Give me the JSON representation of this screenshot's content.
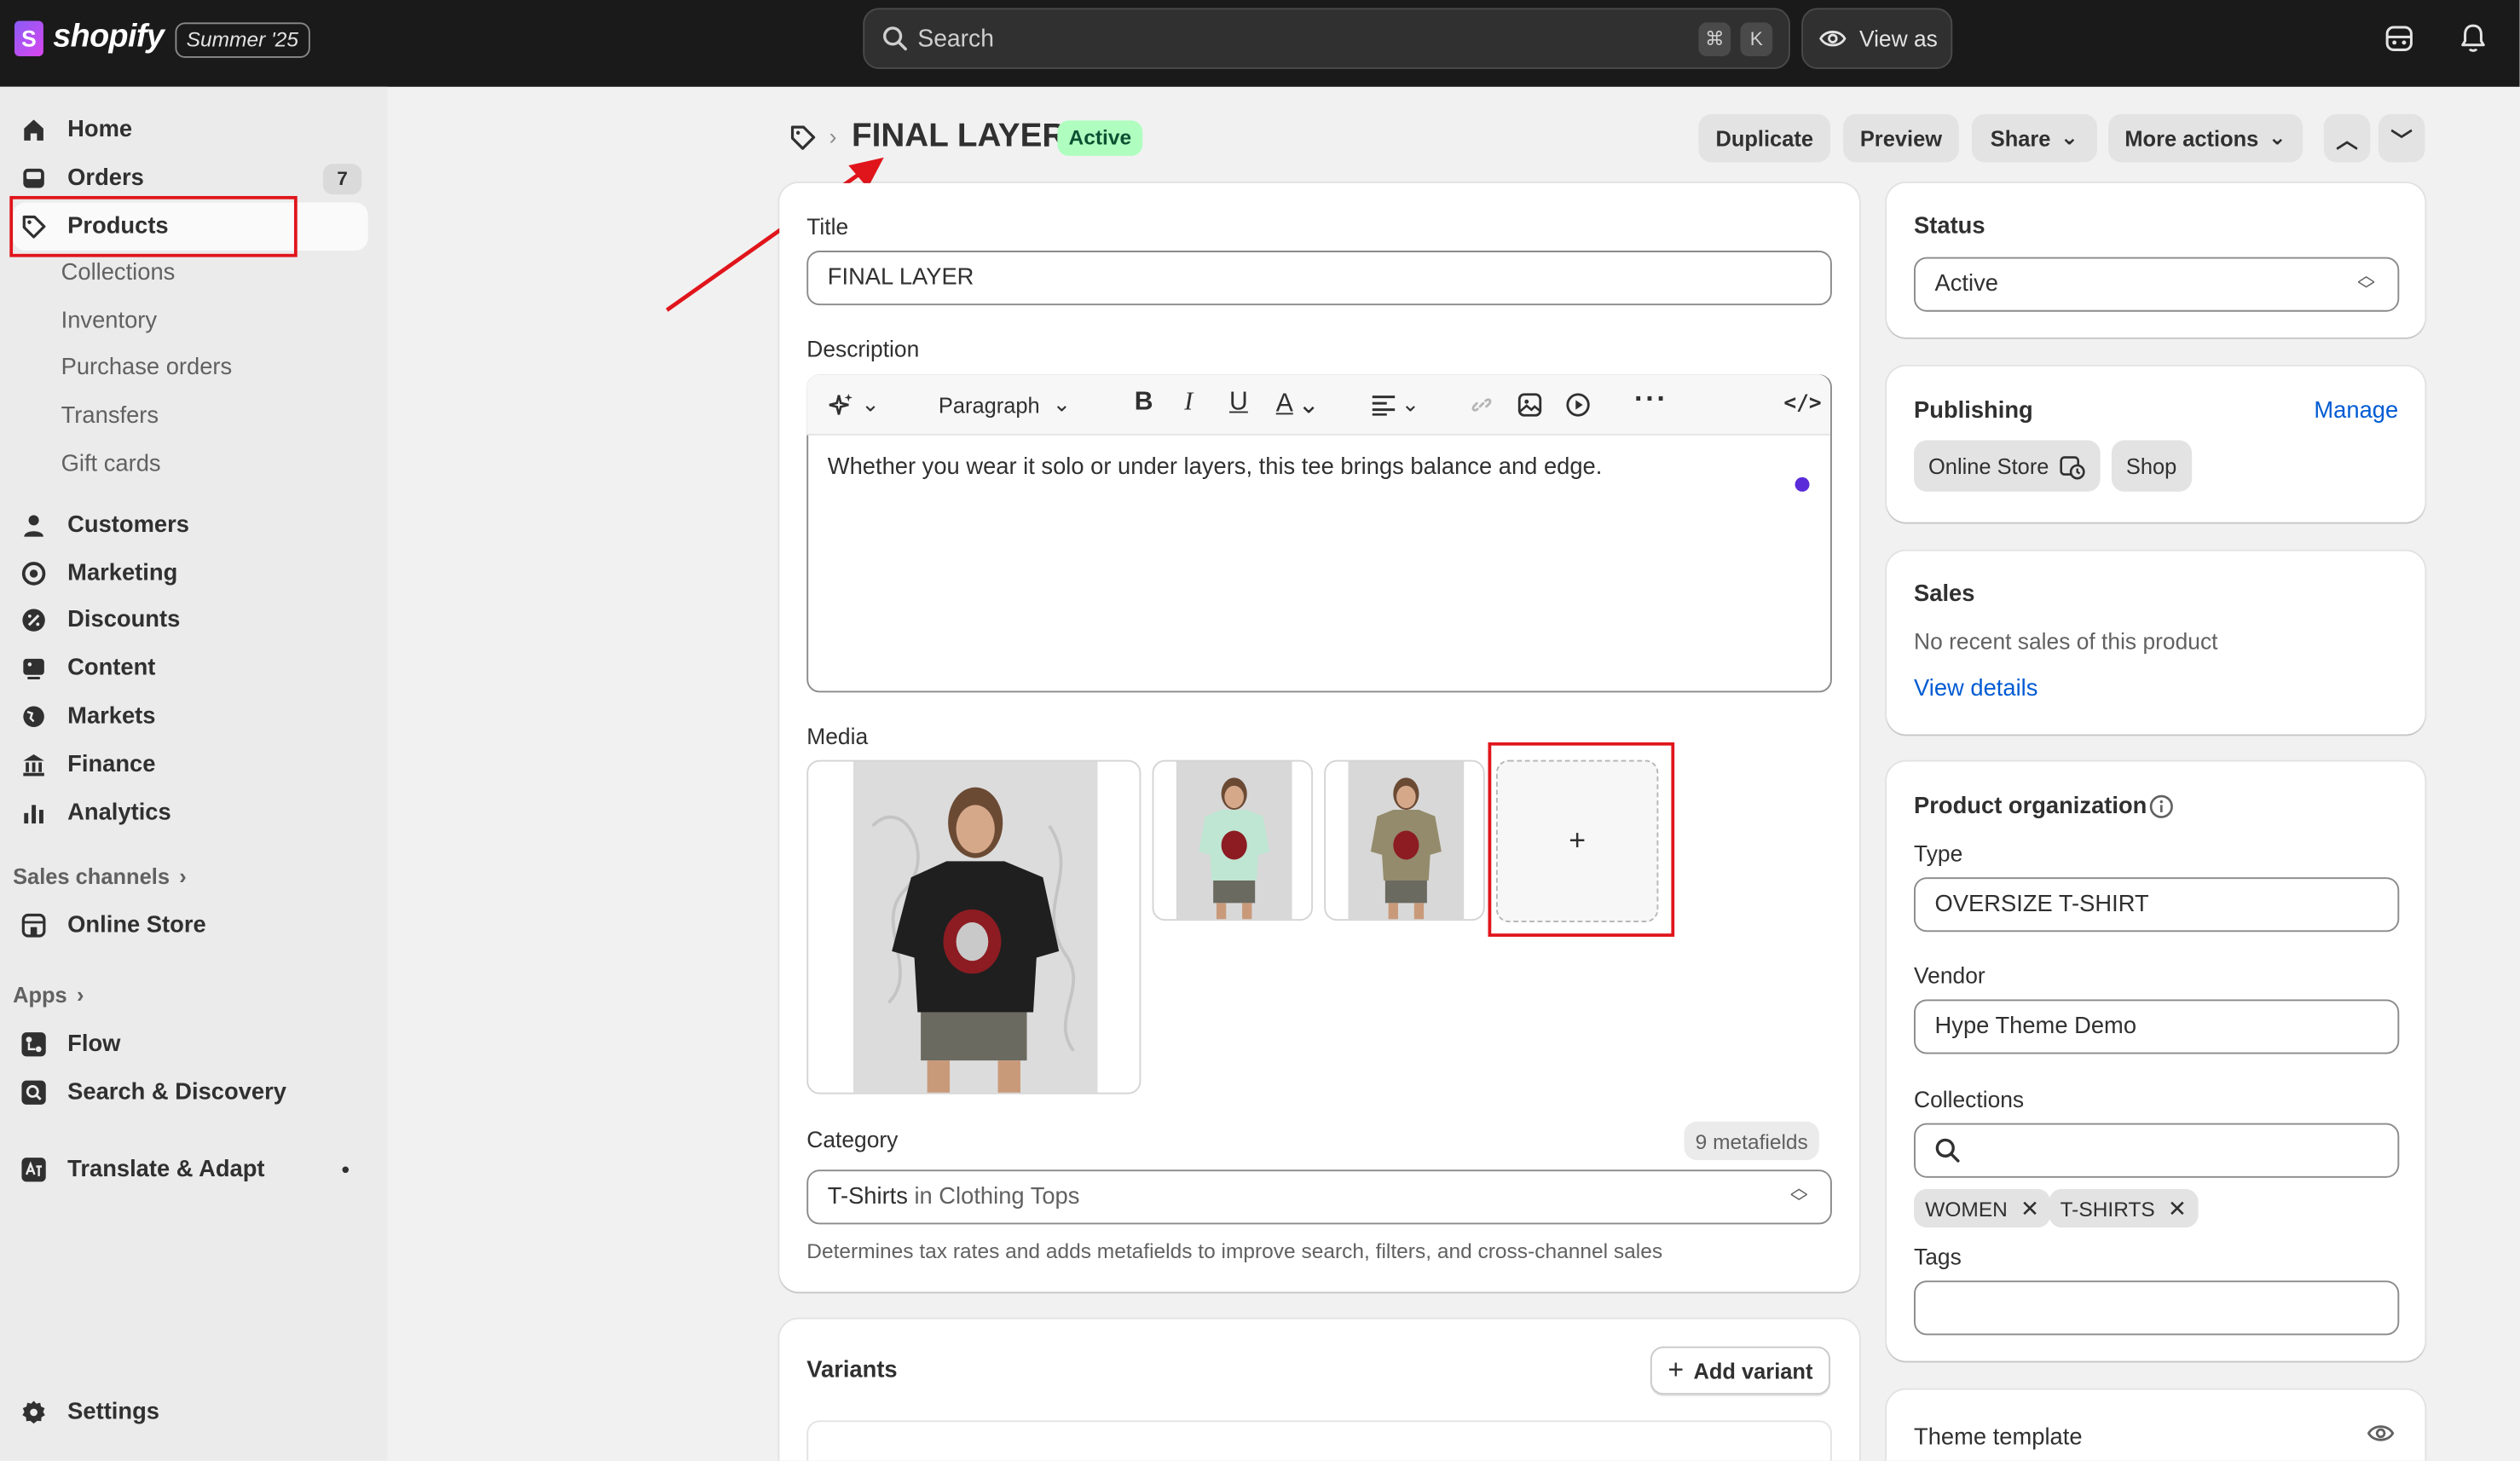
{
  "topbar": {
    "brand": "shopify",
    "edition": "Summer '25",
    "search_placeholder": "Search",
    "shortcut_cmd": "⌘",
    "shortcut_key": "K",
    "view_as": "View as"
  },
  "sidebar": {
    "items": [
      {
        "label": "Home"
      },
      {
        "label": "Orders",
        "badge": "7"
      },
      {
        "label": "Products"
      },
      {
        "label": "Customers"
      },
      {
        "label": "Marketing"
      },
      {
        "label": "Discounts"
      },
      {
        "label": "Content"
      },
      {
        "label": "Markets"
      },
      {
        "label": "Finance"
      },
      {
        "label": "Analytics"
      }
    ],
    "product_subitems": [
      "Collections",
      "Inventory",
      "Purchase orders",
      "Transfers",
      "Gift cards"
    ],
    "sales_channels_label": "Sales channels",
    "online_store": "Online Store",
    "apps_label": "Apps",
    "apps": [
      "Flow",
      "Search & Discovery",
      "Translate & Adapt"
    ],
    "settings": "Settings"
  },
  "header": {
    "title": "FINAL LAYER",
    "status": "Active",
    "buttons": {
      "duplicate": "Duplicate",
      "preview": "Preview",
      "share": "Share",
      "more_actions": "More actions"
    }
  },
  "product": {
    "title_label": "Title",
    "title_value": "FINAL LAYER",
    "description_label": "Description",
    "paragraph_style": "Paragraph",
    "description_text": "Whether you wear it solo or under layers, this tee brings balance and edge.",
    "media_label": "Media",
    "add_media": "+",
    "category_label": "Category",
    "metafields": "9 metafields",
    "category_main": "T-Shirts",
    "category_in": "in",
    "category_parent": "Clothing Tops",
    "category_help": "Determines tax rates and adds metafields to improve search, filters, and cross-channel sales",
    "variants_label": "Variants",
    "add_variant": "Add variant"
  },
  "right": {
    "status_label": "Status",
    "status_value": "Active",
    "publishing_label": "Publishing",
    "manage": "Manage",
    "channels": [
      "Online Store",
      "Shop"
    ],
    "sales_label": "Sales",
    "sales_text": "No recent sales of this product",
    "view_details": "View details",
    "org_label": "Product organization",
    "type_label": "Type",
    "type_value": "OVERSIZE T-SHIRT",
    "vendor_label": "Vendor",
    "vendor_value": "Hype Theme Demo",
    "collections_label": "Collections",
    "collection_tags": [
      "WOMEN",
      "T-SHIRTS"
    ],
    "tags_label": "Tags",
    "theme_template_label": "Theme template"
  },
  "colors": {
    "topbar_bg": "#1a1a1a",
    "sidebar_bg": "#ebebeb",
    "page_bg": "#f1f1f1",
    "active_badge_bg": "#affebf",
    "link": "#005bd3",
    "annotation_red": "#e0151b"
  }
}
